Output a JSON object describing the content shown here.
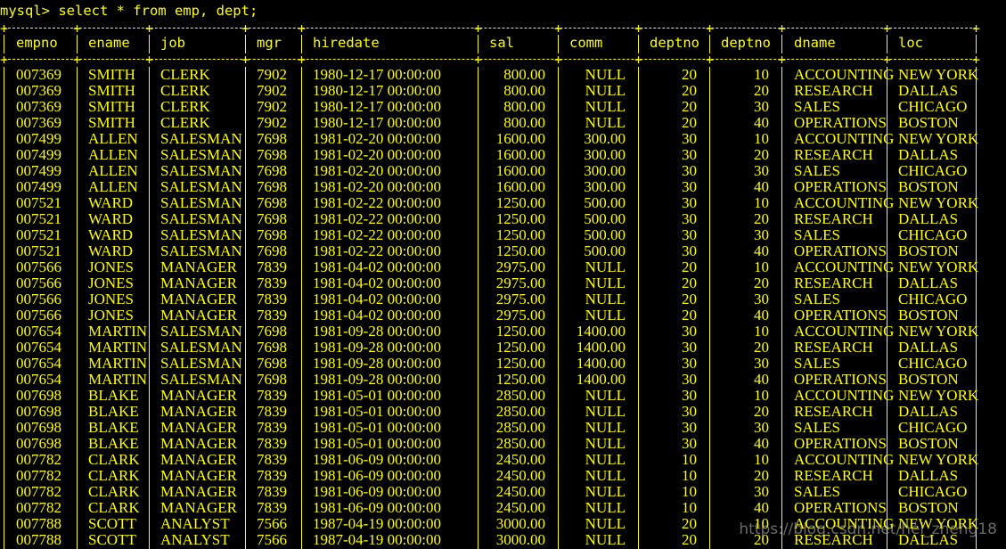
{
  "terminal": {
    "prompt": "mysql> select * from emp, dept;",
    "text_color": "#ffff00",
    "background": "#000000"
  },
  "table": {
    "columns": [
      "empno",
      "ename",
      "job",
      "mgr",
      "hiredate",
      "sal",
      "comm",
      "deptno",
      "deptno",
      "dname",
      "loc"
    ],
    "rows": [
      [
        "007369",
        "SMITH",
        "CLERK",
        "7902",
        "1980-12-17 00:00:00",
        "800.00",
        "NULL",
        "20",
        "10",
        "ACCOUNTING",
        "NEW YORK"
      ],
      [
        "007369",
        "SMITH",
        "CLERK",
        "7902",
        "1980-12-17 00:00:00",
        "800.00",
        "NULL",
        "20",
        "20",
        "RESEARCH",
        "DALLAS"
      ],
      [
        "007369",
        "SMITH",
        "CLERK",
        "7902",
        "1980-12-17 00:00:00",
        "800.00",
        "NULL",
        "20",
        "30",
        "SALES",
        "CHICAGO"
      ],
      [
        "007369",
        "SMITH",
        "CLERK",
        "7902",
        "1980-12-17 00:00:00",
        "800.00",
        "NULL",
        "20",
        "40",
        "OPERATIONS",
        "BOSTON"
      ],
      [
        "007499",
        "ALLEN",
        "SALESMAN",
        "7698",
        "1981-02-20 00:00:00",
        "1600.00",
        "300.00",
        "30",
        "10",
        "ACCOUNTING",
        "NEW YORK"
      ],
      [
        "007499",
        "ALLEN",
        "SALESMAN",
        "7698",
        "1981-02-20 00:00:00",
        "1600.00",
        "300.00",
        "30",
        "20",
        "RESEARCH",
        "DALLAS"
      ],
      [
        "007499",
        "ALLEN",
        "SALESMAN",
        "7698",
        "1981-02-20 00:00:00",
        "1600.00",
        "300.00",
        "30",
        "30",
        "SALES",
        "CHICAGO"
      ],
      [
        "007499",
        "ALLEN",
        "SALESMAN",
        "7698",
        "1981-02-20 00:00:00",
        "1600.00",
        "300.00",
        "30",
        "40",
        "OPERATIONS",
        "BOSTON"
      ],
      [
        "007521",
        "WARD",
        "SALESMAN",
        "7698",
        "1981-02-22 00:00:00",
        "1250.00",
        "500.00",
        "30",
        "10",
        "ACCOUNTING",
        "NEW YORK"
      ],
      [
        "007521",
        "WARD",
        "SALESMAN",
        "7698",
        "1981-02-22 00:00:00",
        "1250.00",
        "500.00",
        "30",
        "20",
        "RESEARCH",
        "DALLAS"
      ],
      [
        "007521",
        "WARD",
        "SALESMAN",
        "7698",
        "1981-02-22 00:00:00",
        "1250.00",
        "500.00",
        "30",
        "30",
        "SALES",
        "CHICAGO"
      ],
      [
        "007521",
        "WARD",
        "SALESMAN",
        "7698",
        "1981-02-22 00:00:00",
        "1250.00",
        "500.00",
        "30",
        "40",
        "OPERATIONS",
        "BOSTON"
      ],
      [
        "007566",
        "JONES",
        "MANAGER",
        "7839",
        "1981-04-02 00:00:00",
        "2975.00",
        "NULL",
        "20",
        "10",
        "ACCOUNTING",
        "NEW YORK"
      ],
      [
        "007566",
        "JONES",
        "MANAGER",
        "7839",
        "1981-04-02 00:00:00",
        "2975.00",
        "NULL",
        "20",
        "20",
        "RESEARCH",
        "DALLAS"
      ],
      [
        "007566",
        "JONES",
        "MANAGER",
        "7839",
        "1981-04-02 00:00:00",
        "2975.00",
        "NULL",
        "20",
        "30",
        "SALES",
        "CHICAGO"
      ],
      [
        "007566",
        "JONES",
        "MANAGER",
        "7839",
        "1981-04-02 00:00:00",
        "2975.00",
        "NULL",
        "20",
        "40",
        "OPERATIONS",
        "BOSTON"
      ],
      [
        "007654",
        "MARTIN",
        "SALESMAN",
        "7698",
        "1981-09-28 00:00:00",
        "1250.00",
        "1400.00",
        "30",
        "10",
        "ACCOUNTING",
        "NEW YORK"
      ],
      [
        "007654",
        "MARTIN",
        "SALESMAN",
        "7698",
        "1981-09-28 00:00:00",
        "1250.00",
        "1400.00",
        "30",
        "20",
        "RESEARCH",
        "DALLAS"
      ],
      [
        "007654",
        "MARTIN",
        "SALESMAN",
        "7698",
        "1981-09-28 00:00:00",
        "1250.00",
        "1400.00",
        "30",
        "30",
        "SALES",
        "CHICAGO"
      ],
      [
        "007654",
        "MARTIN",
        "SALESMAN",
        "7698",
        "1981-09-28 00:00:00",
        "1250.00",
        "1400.00",
        "30",
        "40",
        "OPERATIONS",
        "BOSTON"
      ],
      [
        "007698",
        "BLAKE",
        "MANAGER",
        "7839",
        "1981-05-01 00:00:00",
        "2850.00",
        "NULL",
        "30",
        "10",
        "ACCOUNTING",
        "NEW YORK"
      ],
      [
        "007698",
        "BLAKE",
        "MANAGER",
        "7839",
        "1981-05-01 00:00:00",
        "2850.00",
        "NULL",
        "30",
        "20",
        "RESEARCH",
        "DALLAS"
      ],
      [
        "007698",
        "BLAKE",
        "MANAGER",
        "7839",
        "1981-05-01 00:00:00",
        "2850.00",
        "NULL",
        "30",
        "30",
        "SALES",
        "CHICAGO"
      ],
      [
        "007698",
        "BLAKE",
        "MANAGER",
        "7839",
        "1981-05-01 00:00:00",
        "2850.00",
        "NULL",
        "30",
        "40",
        "OPERATIONS",
        "BOSTON"
      ],
      [
        "007782",
        "CLARK",
        "MANAGER",
        "7839",
        "1981-06-09 00:00:00",
        "2450.00",
        "NULL",
        "10",
        "10",
        "ACCOUNTING",
        "NEW YORK"
      ],
      [
        "007782",
        "CLARK",
        "MANAGER",
        "7839",
        "1981-06-09 00:00:00",
        "2450.00",
        "NULL",
        "10",
        "20",
        "RESEARCH",
        "DALLAS"
      ],
      [
        "007782",
        "CLARK",
        "MANAGER",
        "7839",
        "1981-06-09 00:00:00",
        "2450.00",
        "NULL",
        "10",
        "30",
        "SALES",
        "CHICAGO"
      ],
      [
        "007782",
        "CLARK",
        "MANAGER",
        "7839",
        "1981-06-09 00:00:00",
        "2450.00",
        "NULL",
        "10",
        "40",
        "OPERATIONS",
        "BOSTON"
      ],
      [
        "007788",
        "SCOTT",
        "ANALYST",
        "7566",
        "1987-04-19 00:00:00",
        "3000.00",
        "NULL",
        "20",
        "10",
        "ACCOUNTING",
        "NEW YORK"
      ],
      [
        "007788",
        "SCOTT",
        "ANALYST",
        "7566",
        "1987-04-19 00:00:00",
        "3000.00",
        "NULL",
        "20",
        "20",
        "RESEARCH",
        "DALLAS"
      ]
    ]
  },
  "watermark": "https://blog.csdn.net/hei_zheng18"
}
